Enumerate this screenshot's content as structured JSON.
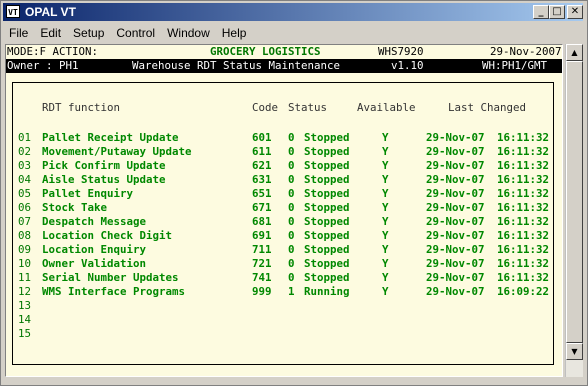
{
  "window": {
    "icon_label": "VT",
    "title": "OPAL VT",
    "minimize": "_",
    "maximize": "□",
    "close": "✕"
  },
  "menu": [
    "File",
    "Edit",
    "Setup",
    "Control",
    "Window",
    "Help"
  ],
  "header1": {
    "left": "MODE:F ACTION:",
    "center": "GROCERY LOGISTICS",
    "code": "WHS7920",
    "date": "29-Nov-2007"
  },
  "header2": {
    "owner": "Owner : PH1",
    "screen_title": "Warehouse RDT Status Maintenance",
    "version": "v1.10",
    "warehouse": "WH:PH1/GMT"
  },
  "columns": {
    "function": "RDT function",
    "code": "Code",
    "status": "Status",
    "available": "Available",
    "last_changed": "Last Changed"
  },
  "rows": [
    {
      "num": "01",
      "function": "Pallet Receipt Update",
      "code": "601",
      "status_code": "0",
      "status": "Stopped",
      "available": "Y",
      "date": "29-Nov-07",
      "time": "16:11:32"
    },
    {
      "num": "02",
      "function": "Movement/Putaway Update",
      "code": "611",
      "status_code": "0",
      "status": "Stopped",
      "available": "Y",
      "date": "29-Nov-07",
      "time": "16:11:32"
    },
    {
      "num": "03",
      "function": "Pick Confirm Update",
      "code": "621",
      "status_code": "0",
      "status": "Stopped",
      "available": "Y",
      "date": "29-Nov-07",
      "time": "16:11:32"
    },
    {
      "num": "04",
      "function": "Aisle Status Update",
      "code": "631",
      "status_code": "0",
      "status": "Stopped",
      "available": "Y",
      "date": "29-Nov-07",
      "time": "16:11:32"
    },
    {
      "num": "05",
      "function": "Pallet Enquiry",
      "code": "651",
      "status_code": "0",
      "status": "Stopped",
      "available": "Y",
      "date": "29-Nov-07",
      "time": "16:11:32"
    },
    {
      "num": "06",
      "function": "Stock Take",
      "code": "671",
      "status_code": "0",
      "status": "Stopped",
      "available": "Y",
      "date": "29-Nov-07",
      "time": "16:11:32"
    },
    {
      "num": "07",
      "function": "Despatch Message",
      "code": "681",
      "status_code": "0",
      "status": "Stopped",
      "available": "Y",
      "date": "29-Nov-07",
      "time": "16:11:32"
    },
    {
      "num": "08",
      "function": "Location Check Digit",
      "code": "691",
      "status_code": "0",
      "status": "Stopped",
      "available": "Y",
      "date": "29-Nov-07",
      "time": "16:11:32"
    },
    {
      "num": "09",
      "function": "Location Enquiry",
      "code": "711",
      "status_code": "0",
      "status": "Stopped",
      "available": "Y",
      "date": "29-Nov-07",
      "time": "16:11:32"
    },
    {
      "num": "10",
      "function": "Owner Validation",
      "code": "721",
      "status_code": "0",
      "status": "Stopped",
      "available": "Y",
      "date": "29-Nov-07",
      "time": "16:11:32"
    },
    {
      "num": "11",
      "function": "Serial Number Updates",
      "code": "741",
      "status_code": "0",
      "status": "Stopped",
      "available": "Y",
      "date": "29-Nov-07",
      "time": "16:11:32"
    },
    {
      "num": "12",
      "function": "WMS Interface Programs",
      "code": "999",
      "status_code": "1",
      "status": "Running",
      "available": "Y",
      "date": "29-Nov-07",
      "time": "16:09:22"
    },
    {
      "num": "13",
      "function": "",
      "code": "",
      "status_code": "",
      "status": "",
      "available": "",
      "date": "",
      "time": ""
    },
    {
      "num": "14",
      "function": "",
      "code": "",
      "status_code": "",
      "status": "",
      "available": "",
      "date": "",
      "time": ""
    },
    {
      "num": "15",
      "function": "",
      "code": "",
      "status_code": "",
      "status": "",
      "available": "",
      "date": "",
      "time": ""
    }
  ],
  "scrollbar": {
    "up": "▲",
    "down": "▼"
  }
}
